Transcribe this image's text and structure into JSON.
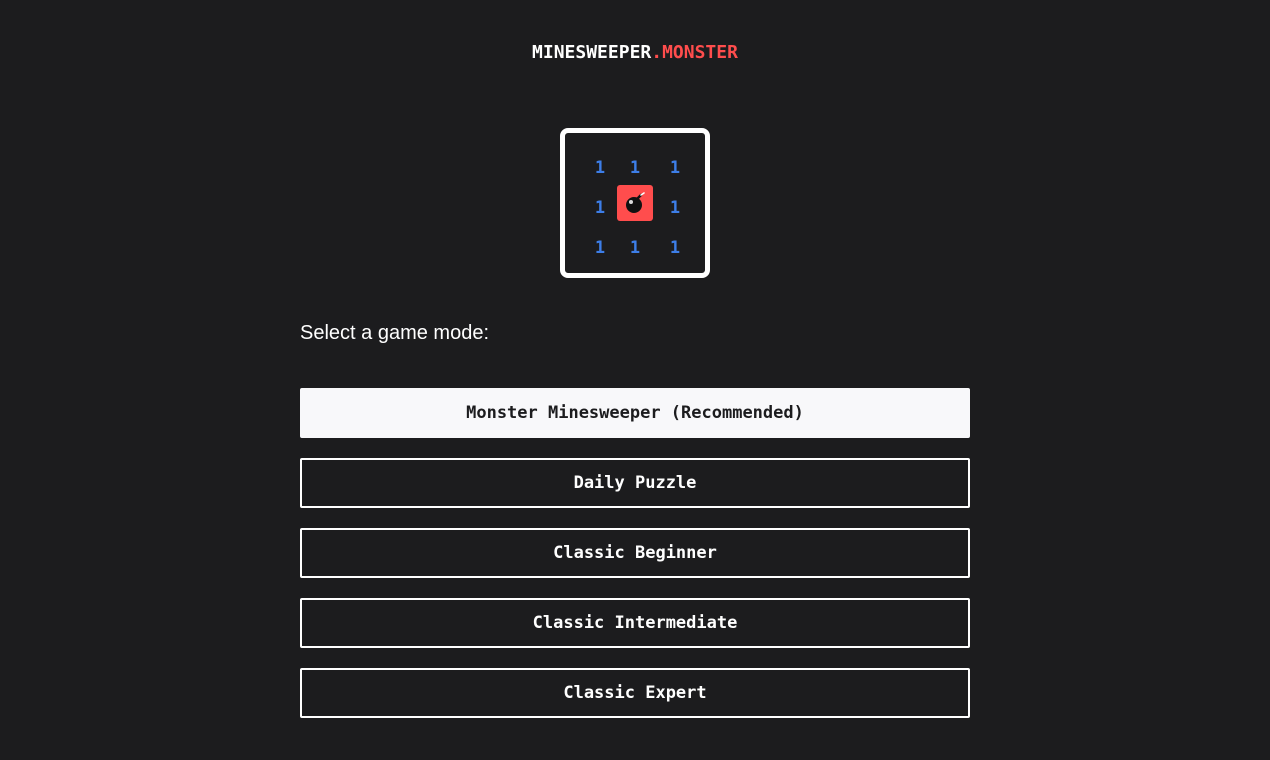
{
  "header": {
    "logo_part1": "MINESWEEPER",
    "logo_part2": ".MONSTER"
  },
  "board": {
    "cells": [
      "1",
      "1",
      "1",
      "1",
      "mine",
      "1",
      "1",
      "1",
      "1"
    ],
    "mine_icon": "bomb-icon",
    "number_color": "#3d7ee8",
    "mine_color": "#ff4d4d"
  },
  "main": {
    "prompt": "Select a game mode:",
    "modes": [
      {
        "label": "Monster Minesweeper (Recommended)",
        "primary": true
      },
      {
        "label": "Daily Puzzle",
        "primary": false
      },
      {
        "label": "Classic Beginner",
        "primary": false
      },
      {
        "label": "Classic Intermediate",
        "primary": false
      },
      {
        "label": "Classic Expert",
        "primary": false
      }
    ]
  },
  "colors": {
    "background": "#1c1c1e",
    "accent": "#ff4d4d",
    "button_primary_bg": "#f8f8fa"
  }
}
